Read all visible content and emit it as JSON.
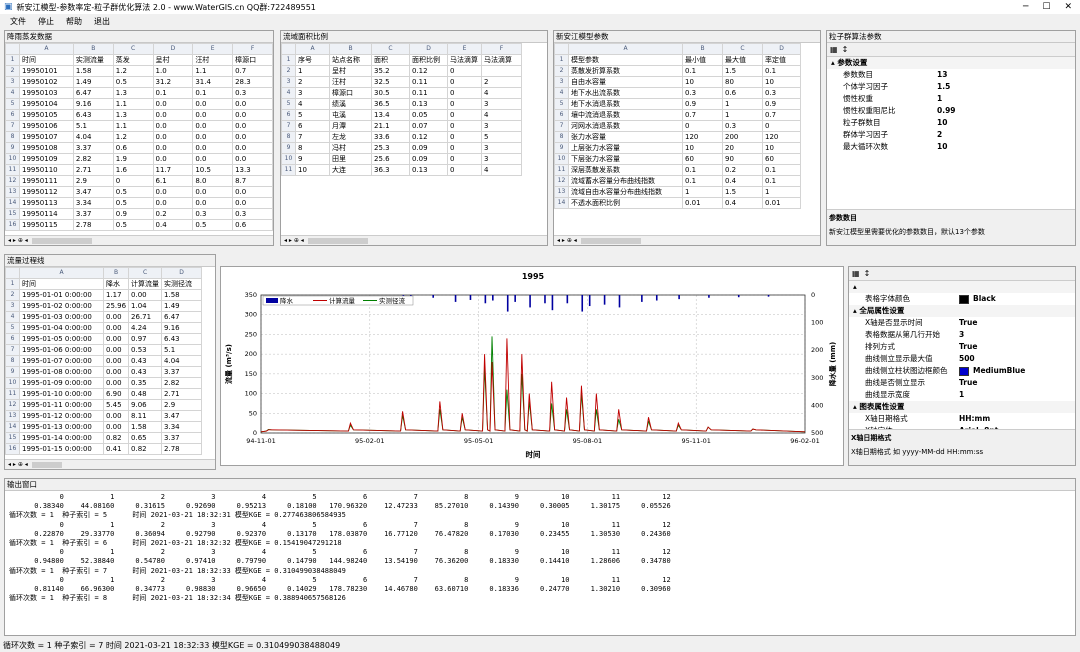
{
  "window": {
    "title": "新安江模型-参数率定-粒子群优化算法 2.0 - www.WaterGIS.cn QQ群:722489551"
  },
  "menu": [
    "文件",
    "停止",
    "帮助",
    "退出"
  ],
  "rain": {
    "title": "降雨蒸发数据",
    "cols": [
      "A",
      "B",
      "C",
      "D",
      "E",
      "F"
    ],
    "rows": [
      [
        "时间",
        "实测流量",
        "蒸发",
        "呈村",
        "汪村",
        "樟源口"
      ],
      [
        "19950101",
        "1.58",
        "1.2",
        "1.0",
        "1.1",
        "0.7"
      ],
      [
        "19950102",
        "1.49",
        "0.5",
        "31.2",
        "31.4",
        "28.3"
      ],
      [
        "19950103",
        "6.47",
        "1.3",
        "0.1",
        "0.1",
        "0.3"
      ],
      [
        "19950104",
        "9.16",
        "1.1",
        "0.0",
        "0.0",
        "0.0"
      ],
      [
        "19950105",
        "6.43",
        "1.3",
        "0.0",
        "0.0",
        "0.0"
      ],
      [
        "19950106",
        "5.1",
        "1.1",
        "0.0",
        "0.0",
        "0.0"
      ],
      [
        "19950107",
        "4.04",
        "1.2",
        "0.0",
        "0.0",
        "0.0"
      ],
      [
        "19950108",
        "3.37",
        "0.6",
        "0.0",
        "0.0",
        "0.0"
      ],
      [
        "19950109",
        "2.82",
        "1.9",
        "0.0",
        "0.0",
        "0.0"
      ],
      [
        "19950110",
        "2.71",
        "1.6",
        "11.7",
        "10.5",
        "13.3"
      ],
      [
        "19950111",
        "2.9",
        "0",
        "6.1",
        "8.0",
        "8.7"
      ],
      [
        "19950112",
        "3.47",
        "0.5",
        "0.0",
        "0.0",
        "0.0"
      ],
      [
        "19950113",
        "3.34",
        "0.5",
        "0.0",
        "0.0",
        "0.0"
      ],
      [
        "19950114",
        "3.37",
        "0.9",
        "0.2",
        "0.3",
        "0.3"
      ],
      [
        "19950115",
        "2.78",
        "0.5",
        "0.4",
        "0.5",
        "0.6"
      ]
    ]
  },
  "basin": {
    "title": "流域面积比例",
    "cols": [
      "A",
      "B",
      "C",
      "D",
      "E",
      "F"
    ],
    "rows": [
      [
        "序号",
        "站点名称",
        "面积",
        "面积比例",
        "马法滴算",
        "马法滴算"
      ],
      [
        "1",
        "呈村",
        "35.2",
        "0.12",
        "0",
        ""
      ],
      [
        "2",
        "汪村",
        "32.5",
        "0.11",
        "0",
        "2"
      ],
      [
        "3",
        "樟源口",
        "30.5",
        "0.11",
        "0",
        "4"
      ],
      [
        "4",
        "绩溪",
        "36.5",
        "0.13",
        "0",
        "3"
      ],
      [
        "5",
        "屯溪",
        "13.4",
        "0.05",
        "0",
        "4"
      ],
      [
        "6",
        "月潭",
        "21.1",
        "0.07",
        "0",
        "3"
      ],
      [
        "7",
        "左龙",
        "33.6",
        "0.12",
        "0",
        "5"
      ],
      [
        "8",
        "冯村",
        "25.3",
        "0.09",
        "0",
        "3"
      ],
      [
        "9",
        "田里",
        "25.6",
        "0.09",
        "0",
        "3"
      ],
      [
        "10",
        "大连",
        "36.3",
        "0.13",
        "0",
        "4"
      ]
    ]
  },
  "xaj": {
    "title": "新安江模型参数",
    "cols": [
      "A",
      "B",
      "C",
      "D"
    ],
    "rows": [
      [
        "模型参数",
        "最小值",
        "最大值",
        "率定值"
      ],
      [
        "蒸散发折算系数",
        "0.1",
        "1.5",
        "0.1"
      ],
      [
        "自由水容量",
        "10",
        "80",
        "10"
      ],
      [
        "地下水出流系数",
        "0.3",
        "0.6",
        "0.3"
      ],
      [
        "地下水消退系数",
        "0.9",
        "1",
        "0.9"
      ],
      [
        "壤中流消退系数",
        "0.7",
        "1",
        "0.7"
      ],
      [
        "河网水消退系数",
        "0",
        "0.3",
        "0"
      ],
      [
        "张力水容量",
        "120",
        "200",
        "120"
      ],
      [
        "上层张力水容量",
        "10",
        "20",
        "10"
      ],
      [
        "下层张力水容量",
        "60",
        "90",
        "60"
      ],
      [
        "深层蒸散发系数",
        "0.1",
        "0.2",
        "0.1"
      ],
      [
        "流域蓄水容量分布曲线指数",
        "0.1",
        "0.4",
        "0.1"
      ],
      [
        "流域自由水容量分布曲线指数",
        "1",
        "1.5",
        "1"
      ],
      [
        "不透水面积比例",
        "0.01",
        "0.4",
        "0.01"
      ]
    ]
  },
  "pso": {
    "title": "粒子群算法参数",
    "category": "参数设置",
    "props": [
      [
        "参数数目",
        "13"
      ],
      [
        "个体学习因子",
        "1.5"
      ],
      [
        "惯性权重",
        "1"
      ],
      [
        "惯性权重阻尼比",
        "0.99"
      ],
      [
        "粒子群数目",
        "10"
      ],
      [
        "群体学习因子",
        "2"
      ],
      [
        "最大循环次数",
        "10"
      ]
    ],
    "desc_title": "参数数目",
    "desc_text": "新安江模型里需要优化的参数数目，默认13个参数"
  },
  "flow": {
    "title": "流量过程线",
    "cols": [
      "A",
      "B",
      "C",
      "D"
    ],
    "rows": [
      [
        "时间",
        "降水",
        "计算流量",
        "实测径流"
      ],
      [
        "1995-01-01 0:00:00",
        "1.17",
        "0.00",
        "1.58"
      ],
      [
        "1995-01-02 0:00:00",
        "25.96",
        "1.04",
        "1.49"
      ],
      [
        "1995-01-03 0:00:00",
        "0.00",
        "26.71",
        "6.47"
      ],
      [
        "1995-01-04 0:00:00",
        "0.00",
        "4.24",
        "9.16"
      ],
      [
        "1995-01-05 0:00:00",
        "0.00",
        "0.97",
        "6.43"
      ],
      [
        "1995-01-06 0:00:00",
        "0.00",
        "0.53",
        "5.1"
      ],
      [
        "1995-01-07 0:00:00",
        "0.00",
        "0.43",
        "4.04"
      ],
      [
        "1995-01-08 0:00:00",
        "0.00",
        "0.43",
        "3.37"
      ],
      [
        "1995-01-09 0:00:00",
        "0.00",
        "0.35",
        "2.82"
      ],
      [
        "1995-01-10 0:00:00",
        "6.90",
        "0.48",
        "2.71"
      ],
      [
        "1995-01-11 0:00:00",
        "5.45",
        "9.06",
        "2.9"
      ],
      [
        "1995-01-12 0:00:00",
        "0.00",
        "8.11",
        "3.47"
      ],
      [
        "1995-01-13 0:00:00",
        "0.00",
        "1.58",
        "3.34"
      ],
      [
        "1995-01-14 0:00:00",
        "0.82",
        "0.65",
        "3.37"
      ],
      [
        "1995-01-15 0:00:00",
        "0.41",
        "0.82",
        "2.78"
      ]
    ]
  },
  "chart_data": {
    "type": "line",
    "title": "1995",
    "xlabel": "时间",
    "ylabel": "流量 (m³/s)",
    "y2label": "降水量 (mm)",
    "ylim": [
      0,
      350
    ],
    "yticks": [
      0,
      50,
      100,
      150,
      200,
      250,
      300,
      350
    ],
    "y2lim": [
      0,
      500
    ],
    "y2ticks": [
      0,
      100,
      200,
      300,
      400,
      500
    ],
    "xticks": [
      "94-11-01",
      "95-02-01",
      "95-05-01",
      "95-08-01",
      "95-11-01",
      "96-02-01"
    ],
    "legend": [
      "降水",
      "计算流量",
      "实测径流"
    ],
    "colors": {
      "rain": "#0000a0",
      "calc": "#c00000",
      "obs": "#008000"
    },
    "grid": true,
    "rain_events": [
      [
        95,
        8
      ],
      [
        100,
        6
      ],
      [
        115,
        10
      ],
      [
        130,
        25
      ],
      [
        140,
        18
      ],
      [
        150,
        30
      ],
      [
        155,
        20
      ],
      [
        165,
        60
      ],
      [
        170,
        25
      ],
      [
        180,
        45
      ],
      [
        190,
        30
      ],
      [
        195,
        55
      ],
      [
        205,
        30
      ],
      [
        215,
        60
      ],
      [
        220,
        40
      ],
      [
        230,
        35
      ],
      [
        240,
        45
      ],
      [
        255,
        25
      ],
      [
        265,
        20
      ],
      [
        280,
        15
      ],
      [
        300,
        10
      ],
      [
        320,
        8
      ],
      [
        340,
        6
      ]
    ],
    "obs_peaks": [
      [
        5,
        9
      ],
      [
        60,
        20
      ],
      [
        95,
        45
      ],
      [
        120,
        60
      ],
      [
        135,
        40
      ],
      [
        150,
        165
      ],
      [
        155,
        245
      ],
      [
        165,
        110
      ],
      [
        175,
        150
      ],
      [
        180,
        80
      ],
      [
        195,
        75
      ],
      [
        205,
        60
      ],
      [
        215,
        100
      ],
      [
        225,
        60
      ],
      [
        240,
        35
      ],
      [
        260,
        30
      ],
      [
        280,
        20
      ],
      [
        300,
        15
      ],
      [
        330,
        10
      ]
    ],
    "calc_peaks": [
      [
        5,
        8
      ],
      [
        60,
        25
      ],
      [
        95,
        55
      ],
      [
        120,
        80
      ],
      [
        135,
        50
      ],
      [
        150,
        200
      ],
      [
        155,
        180
      ],
      [
        165,
        240
      ],
      [
        175,
        200
      ],
      [
        180,
        100
      ],
      [
        195,
        130
      ],
      [
        205,
        90
      ],
      [
        215,
        120
      ],
      [
        225,
        100
      ],
      [
        240,
        60
      ],
      [
        260,
        40
      ],
      [
        280,
        25
      ],
      [
        300,
        15
      ],
      [
        330,
        10
      ]
    ]
  },
  "props": {
    "rows": [
      [
        "cat",
        ""
      ],
      [
        "表格字体颜色",
        "Black"
      ],
      [
        "cat",
        "全局属性设置"
      ],
      [
        "X轴是否显示时间",
        "True"
      ],
      [
        "表格数据从第几行开始",
        "3"
      ],
      [
        "排列方式",
        "True"
      ],
      [
        "曲线侧立显示最大值",
        "500"
      ],
      [
        "曲线侧立柱状图边框颜色",
        "MediumBlue"
      ],
      [
        "曲线是否侧立显示",
        "True"
      ],
      [
        "曲线显示宽度",
        "1"
      ],
      [
        "cat",
        "图表属性设置"
      ],
      [
        "X轴日期格式",
        "HH:mm"
      ],
      [
        "X轴字体",
        "Arial, 8pt"
      ]
    ],
    "desc_title": "X轴日期格式",
    "desc_text": "X轴日期格式 如 yyyy-MM-dd HH:mm:ss"
  },
  "output": {
    "title": "输出窗口",
    "text": "            0           1           2           3           4           5           6           7           8           9          10          11          12\n      0.38340    44.08160     0.31615     0.92690     0.95213     0.18100   170.96320    12.47233    85.27010     0.14390     0.30005     1.30175     0.05526\n循环次数 = 1  种子索引 = 5      时间 2021-03-21 18:32:31 模型KGE = 0.277463806584935\n            0           1           2           3           4           5           6           7           8           9          10          11          12\n      0.22870    29.33770     0.36094     0.92790     0.92370     0.13170   178.03870    16.77120    76.47820     0.17030     0.23455     1.30530     0.24360\n循环次数 = 1  种子索引 = 6      时间 2021-03-21 18:32:32 模型KGE = 0.15419047291218\n            0           1           2           3           4           5           6           7           8           9          10          11          12\n      0.94800    52.38840     0.54780     0.97410     0.79790     0.14790   144.98240    13.54190    76.36200     0.18330     0.14410     1.28606     0.34780\n循环次数 = 1  种子索引 = 7      时间 2021-03-21 18:32:33 模型KGE = 0.310499038488049\n            0           1           2           3           4           5           6           7           8           9          10          11          12\n      0.81140    66.96300     0.34773     0.98830     0.96650     0.14029   178.78230    14.46780    63.60710     0.18336     0.24770     1.30210     0.30960\n循环次数 = 1  种子索引 = 8      时间 2021-03-21 18:32:34 模型KGE = 0.388940657568126"
  },
  "status": "循环次数 = 1 种子索引 = 7 时间 2021-03-21 18:32:33 模型KGE = 0.310499038488049"
}
